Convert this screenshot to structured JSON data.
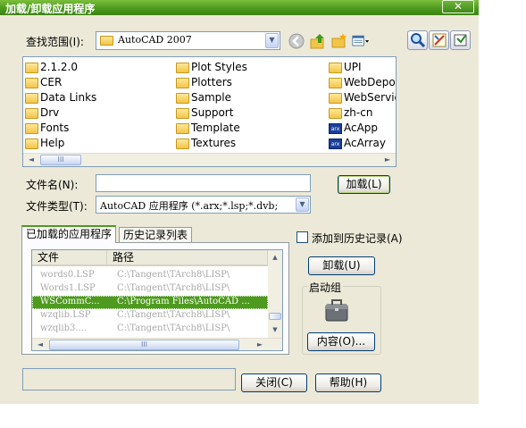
{
  "window": {
    "title": "加载/卸载应用程序",
    "close_label": "✕"
  },
  "look_in": {
    "label": "查找范围(I):",
    "value": "AutoCAD 2007"
  },
  "toolbar_icons": [
    "back-icon",
    "up-folder-icon",
    "new-folder-icon",
    "views-icon",
    "find-icon",
    "tools-icon",
    "extra-icon"
  ],
  "files": {
    "col1": [
      "2.1.2.0",
      "CER",
      "Data Links",
      "Drv",
      "Fonts",
      "Help"
    ],
    "col2": [
      "Plot Styles",
      "Plotters",
      "Sample",
      "Support",
      "Template",
      "Textures"
    ],
    "col3": [
      "UPI",
      "WebDepot",
      "WebServic",
      "zh-cn",
      "AcApp",
      "AcArray"
    ],
    "col3_types": [
      "folder",
      "folder",
      "folder",
      "folder",
      "arx",
      "arx"
    ],
    "arx_badge": "arx",
    "thumb_label": "III"
  },
  "filename": {
    "label": "文件名(N):",
    "value": ""
  },
  "filetype": {
    "label": "文件类型(T):",
    "value": "AutoCAD 应用程序 (*.arx;*.lsp;*.dvb;"
  },
  "load_button": "加载(L)",
  "tabs": [
    {
      "label": "已加载的应用程序",
      "active": true
    },
    {
      "label": "历史记录列表",
      "active": false
    }
  ],
  "add_to_history": {
    "label": "添加到历史记录(A)",
    "checked": false
  },
  "loaded_apps": {
    "headers": [
      "文件",
      "路径"
    ],
    "rows": [
      {
        "file": "words0.LSP",
        "path": "C:\\Tangent\\TArch8\\LISP\\",
        "selected": false
      },
      {
        "file": "Words1.LSP",
        "path": "C:\\Tangent\\TArch8\\LISP\\",
        "selected": false
      },
      {
        "file": "WSCommC...",
        "path": "C:\\Program Files\\AutoCAD ...",
        "selected": true
      },
      {
        "file": "wzqlib.LSP",
        "path": "C:\\Tangent\\TArch8\\LISP\\",
        "selected": false
      },
      {
        "file": "wzqlib3....",
        "path": "C:\\Tangent\\TArch8\\LISP\\",
        "selected": false
      }
    ],
    "thumb_label": "III"
  },
  "unload_button": "卸载(U)",
  "startup_suite": {
    "label": "启动组",
    "contents_button": "内容(O)..."
  },
  "status_text": "",
  "close_button": "关闭(C)",
  "help_button": "帮助(H)"
}
